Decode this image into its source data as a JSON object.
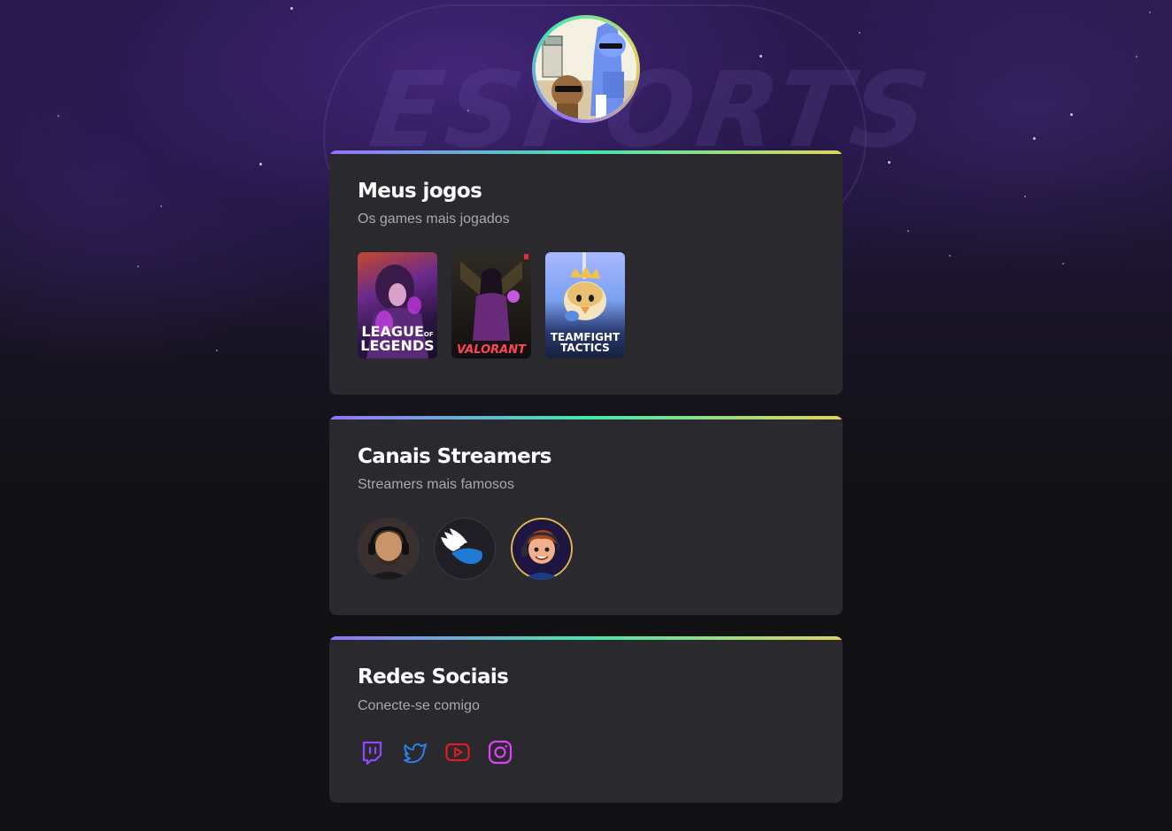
{
  "profile": {
    "avatar_icon": "profile-avatar-cartoon-birds"
  },
  "colors": {
    "gradient_start": "#9572fc",
    "gradient_mid": "#43e7ad",
    "gradient_end": "#e2d45c",
    "card_bg": "#29292e",
    "page_bg": "#121214",
    "twitch": "#9146ff",
    "twitter": "#1d9bf0",
    "youtube": "#e31b23",
    "instagram": "#e040fb"
  },
  "background": {
    "logo_text": "ESPORTS"
  },
  "games": {
    "title": "Meus jogos",
    "subtitle": "Os games mais jogados",
    "items": [
      {
        "name": "League of Legends",
        "line1": "LEAGUE",
        "line1_small": "OF",
        "line2": "LEGENDS",
        "icon": "league-of-legends-cover"
      },
      {
        "name": "Valorant",
        "line1": "VALORANT",
        "icon": "valorant-cover"
      },
      {
        "name": "Teamfight Tactics",
        "line1": "TEAMFIGHT",
        "line2": "TACTICS",
        "icon": "teamfight-tactics-cover"
      }
    ]
  },
  "streamers": {
    "title": "Canais Streamers",
    "subtitle": "Streamers mais famosos",
    "items": [
      {
        "icon": "streamer-avatar-1-headset"
      },
      {
        "icon": "streamer-avatar-2-winged-logo"
      },
      {
        "icon": "streamer-avatar-3-cartoon"
      }
    ]
  },
  "social": {
    "title": "Redes Sociais",
    "subtitle": "Conecte-se comigo",
    "items": [
      {
        "icon": "twitch-icon"
      },
      {
        "icon": "twitter-icon"
      },
      {
        "icon": "youtube-icon"
      },
      {
        "icon": "instagram-icon"
      }
    ]
  }
}
